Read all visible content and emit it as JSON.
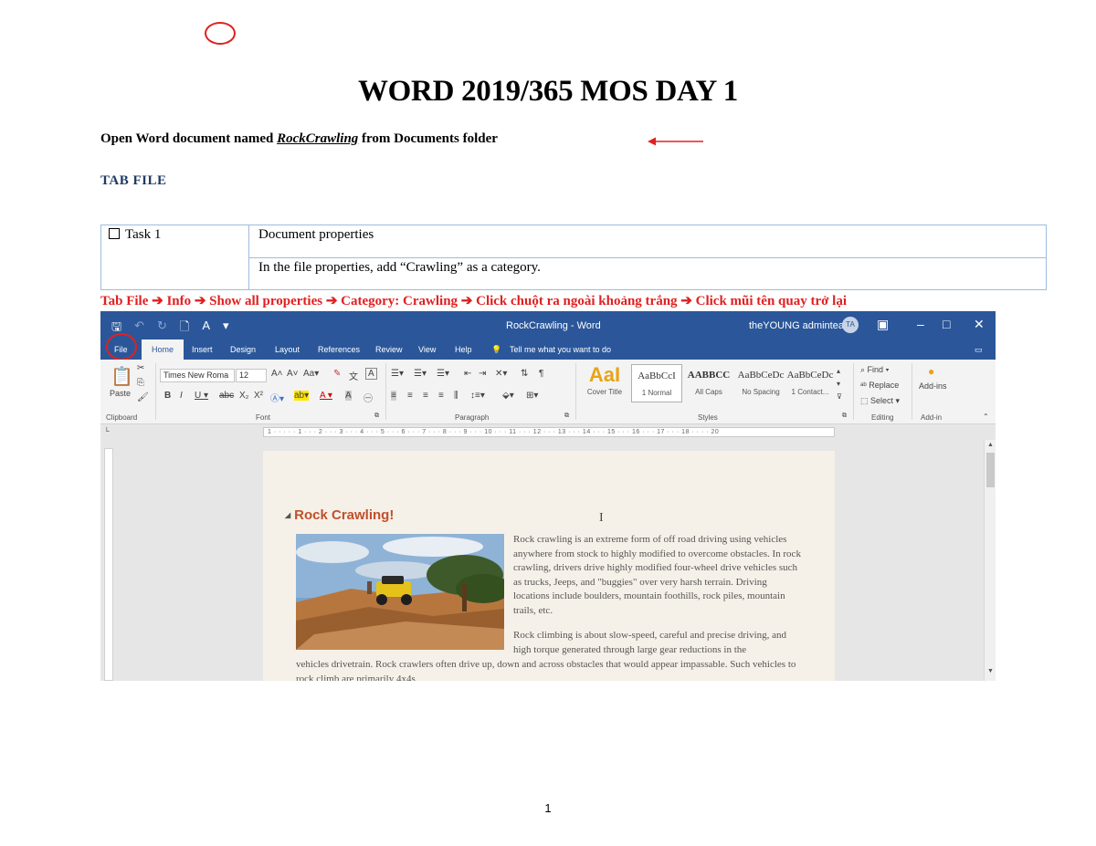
{
  "title": "WORD 2019/365 MOS DAY 1",
  "intro": {
    "prefix": "Open Word document named ",
    "filename": "RockCrawling",
    "suffix": " from Documents folder"
  },
  "section_heading": "TAB FILE",
  "task": {
    "label": "Task 1",
    "topic": "Document properties",
    "instruction": "In the file properties, add “Crawling” as a category."
  },
  "steps": "Tab File ➔ Info ➔ Show all properties ➔ Category: Crawling ➔ Click chuột ra ngoài khoảng trắng ➔ Click mũi tên quay trở lại",
  "page_number": "1",
  "annotation_color": "#e02020",
  "word": {
    "window_title": "RockCrawling - Word",
    "user": "theYOUNG adminteam",
    "avatar_initials": "TA",
    "tabs": {
      "file": "File",
      "home": "Home",
      "insert": "Insert",
      "design": "Design",
      "layout": "Layout",
      "references": "References",
      "review": "Review",
      "view": "View",
      "help": "Help",
      "tell_me": "Tell me what you want to do"
    },
    "ribbon": {
      "paste": "Paste",
      "font_name": "Times New Roma",
      "font_size": "12",
      "styles": [
        "AaBbCcI",
        "AABBCC",
        "AaBbCeDc",
        "AaBbCeDc"
      ],
      "style_names": [
        "1 Normal",
        "All Caps",
        "No Spacing",
        "1 Contact..."
      ],
      "cover_title_preview": "AaI",
      "cover_title": "Cover Title",
      "find": "Find",
      "replace": "Replace",
      "select": "Select",
      "add_ins": "Add-ins",
      "groups": {
        "clipboard": "Clipboard",
        "font": "Font",
        "paragraph": "Paragraph",
        "styles": "Styles",
        "editing": "Editing",
        "add_in": "Add-in"
      }
    },
    "ruler_text": "1 · · · · · 1 · · · 2 · · · 3 · · · 4 · · · 5 · · · 6 · · · 7 · · · 8 · · · 9 · · · 10 · · · 11 · · · 12 · · · 13 · · · 14 · · · 15 · · · 16 · · · 17 · · · 18 · · · · 20",
    "doc": {
      "heading": "Rock Crawling!",
      "para1": "Rock crawling is an extreme form of off road driving using vehicles anywhere from stock to highly modified to overcome obstacles. In rock crawling, drivers drive highly modified four-wheel drive vehicles such as trucks, Jeeps, and \"buggies\" over very harsh terrain. Driving locations include boulders, mountain foothills, rock piles, mountain trails, etc.",
      "para2a": "Rock climbing is about slow-speed, careful and precise driving, and high torque generated through large gear reductions in the",
      "para2b": "vehicles drivetrain. Rock crawlers often drive up, down and across obstacles that would appear impassable. Such vehicles to rock climb are primarily 4x4s"
    }
  }
}
